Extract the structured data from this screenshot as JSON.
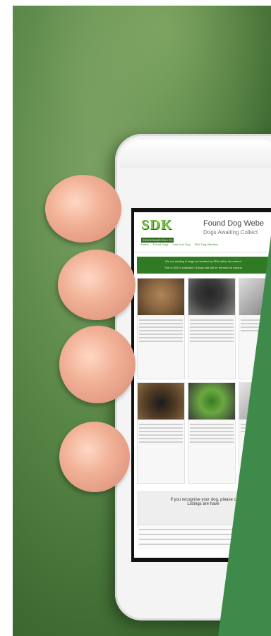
{
  "image": {
    "subject": "hand-holding-phone",
    "colors": {
      "background_green": "#4d7d3d",
      "overlay_green": "#3e8a4a",
      "phone_body": "#f4f4f4",
      "site_banner": "#2f7a22"
    }
  },
  "website": {
    "logo_text": "SDK",
    "logo_subtext": "ENVIRONMENTAL LTD",
    "title": "Found Dog Webe",
    "subtitle": "Dogs Awaiting Collect",
    "nav": [
      "Home",
      "Found Dogs",
      "Lost Your Dog",
      "SDK Dog Wardens"
    ],
    "banner_line1": "We are dealing in dogs as handled by SDK within the area of ",
    "banner_line2": "This is SDK's collection of dogs that will be returned to owners",
    "cta_title": "If you recognise your dog, please c",
    "cta_sub": "Listings are have"
  }
}
